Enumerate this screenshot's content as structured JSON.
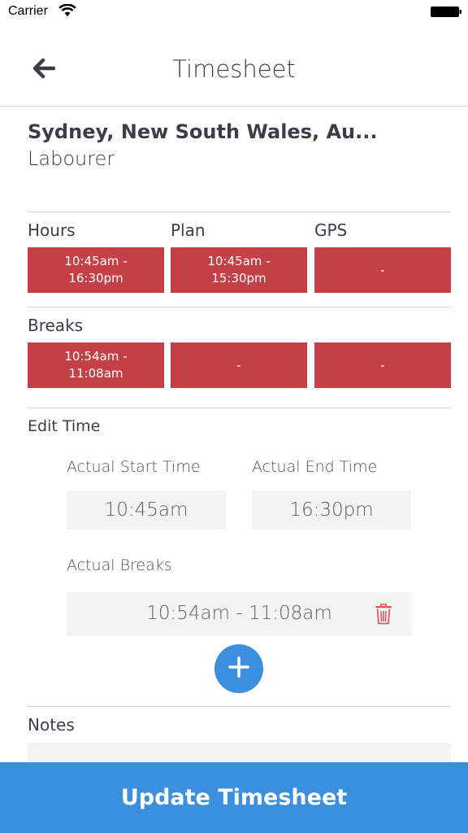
{
  "status_bar": {
    "carrier": "Carrier"
  },
  "nav": {
    "title": "Timesheet"
  },
  "header": {
    "location": "Sydney, New South Wales, Au...",
    "role": "Labourer"
  },
  "hours_section": {
    "labels": [
      "Hours",
      "Plan",
      "GPS"
    ],
    "values": [
      "10:45am - 16:30pm",
      "10:45am - 15:30pm",
      "-"
    ]
  },
  "breaks_section": {
    "label": "Breaks",
    "values": [
      "10:54am - 11:08am",
      "-",
      "-"
    ]
  },
  "edit_time": {
    "label": "Edit Time",
    "start_label": "Actual Start Time",
    "end_label": "Actual End Time",
    "start_value": "10:45am",
    "end_value": "16:30pm",
    "breaks_label": "Actual Breaks",
    "breaks": [
      "10:54am - 11:08am"
    ]
  },
  "notes": {
    "label": "Notes"
  },
  "footer": {
    "update_label": "Update Timesheet"
  },
  "colors": {
    "accent": "#3b8fdc",
    "cell_red": "#c24046",
    "field_bg": "#f3f3f4"
  },
  "icons": [
    "wifi-icon",
    "battery-icon",
    "back-arrow-icon",
    "trash-icon",
    "plus-icon"
  ]
}
